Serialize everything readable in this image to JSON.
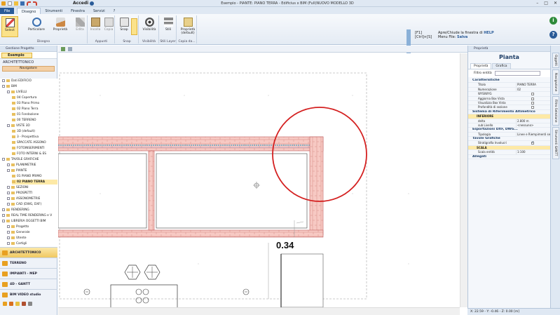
{
  "window": {
    "title": "Esempio - PIANTE: PIANO TERRA - Edificius x BIM (Full)NUOVO MODELLO 3D",
    "access_label": "Accedi",
    "controls": [
      "–",
      "□",
      "✕"
    ]
  },
  "ribbon_tabs": [
    {
      "label": "File"
    },
    {
      "label": "Disegno"
    },
    {
      "label": "Strumenti"
    },
    {
      "label": "Finestra"
    },
    {
      "label": "Servizi"
    },
    {
      "label": "?"
    }
  ],
  "ribbon": {
    "buttons": {
      "select": "Select",
      "particolare": "Particolare",
      "proprieta": "Proprietà",
      "edita": "Edita",
      "incolla": "Incolla",
      "copia": "Copia",
      "snap": "Snap",
      "visibilita": "Visibilità",
      "stili": "Stili",
      "proprieta_default": "Proprietà (default)"
    },
    "groups": {
      "disegno": "Disegno",
      "appunti": "Appunti",
      "snap": "Snap",
      "visibilita": "Visibilità",
      "stili_layer": "Stili Layer",
      "copia_da": "Copia da..."
    }
  },
  "help": {
    "key1": "[F1]",
    "key2": "[Ctrl]+[S]",
    "desc1_pre": "Apre/Chiude la finestra di ",
    "desc1_bold": "HELP",
    "desc2_pre": "Menu File: ",
    "desc2_bold": "Salva"
  },
  "left_panel": {
    "header": "Gestione Progetto",
    "project": "Esempio",
    "section": "ARCHITETTONICO",
    "navigator": "Navigatore",
    "tree": [
      {
        "label": "Dati EDIFICIO",
        "level": 0
      },
      {
        "label": "BIM",
        "level": 0
      },
      {
        "label": "LIVELLI",
        "level": 1
      },
      {
        "label": "04 Copertura",
        "level": 2
      },
      {
        "label": "03 Piano Primo",
        "level": 2
      },
      {
        "label": "02 Piano Terra",
        "level": 2
      },
      {
        "label": "01 Fondazione",
        "level": 2
      },
      {
        "label": "00 TERRENO",
        "level": 2
      },
      {
        "label": "VISTE 3D",
        "level": 1
      },
      {
        "label": "3D (default)",
        "level": 2
      },
      {
        "label": "3 - Prospettiva",
        "level": 2
      },
      {
        "label": "SPACCATE ASSONO",
        "level": 2
      },
      {
        "label": "FOTOINSERIMENTI",
        "level": 2
      },
      {
        "label": "FOTO INTERNI & ES",
        "level": 2
      },
      {
        "label": "TAVOLE GRAFICHE",
        "level": 0
      },
      {
        "label": "PLANIMETRIE",
        "level": 1
      },
      {
        "label": "PIANTE",
        "level": 1
      },
      {
        "label": "01 PIANO PRIMO",
        "level": 2
      },
      {
        "label": "02 PIANO TERRA",
        "level": 2,
        "selected": true
      },
      {
        "label": "SEZIONI",
        "level": 1
      },
      {
        "label": "PROSPETTI",
        "level": 1
      },
      {
        "label": "ASSONOMETRIE",
        "level": 1
      },
      {
        "label": "CAD (DWG, DXF)",
        "level": 1
      },
      {
        "label": "RENDERING",
        "level": 0
      },
      {
        "label": "REAL TIME RENDERING e V",
        "level": 0
      },
      {
        "label": "LIBRERIA OGGETTI BIM",
        "level": 0
      },
      {
        "label": "Progetto",
        "level": 1
      },
      {
        "label": "Generale",
        "level": 1
      },
      {
        "label": "Utente",
        "level": 1
      },
      {
        "label": "Cartigli",
        "level": 1
      }
    ],
    "modules": [
      {
        "label": "ARCHITETTONICO",
        "active": true
      },
      {
        "label": "TERRENO"
      },
      {
        "label": "IMPIANTI - MEP"
      },
      {
        "label": "4D - GANTT"
      },
      {
        "label": "BIM VIDEO studio"
      }
    ]
  },
  "drawing": {
    "dimension_label": "0.34"
  },
  "properties": {
    "panel_header": "Proprietà",
    "title": "Pianta",
    "tabs": [
      "Proprietà",
      "Grafica"
    ],
    "filter_label": "Filtro entità",
    "rows": [
      {
        "type": "sec",
        "label": "Caratteristiche"
      },
      {
        "type": "kv",
        "key": "Titolo",
        "value": "PIANO TERRA"
      },
      {
        "type": "kv",
        "key": "Numerazione",
        "value": "02"
      },
      {
        "type": "cb",
        "key": "WYSIWYG",
        "checked": false
      },
      {
        "type": "cb",
        "key": "Aggiorna Box Vista",
        "checked": false
      },
      {
        "type": "cb",
        "key": "Visualizza Box Vista",
        "checked": false
      },
      {
        "type": "cb",
        "key": "Profondità di sezione",
        "checked": false
      },
      {
        "type": "sec",
        "label": "Sistema di Riferimento Altimetrico"
      },
      {
        "type": "sub",
        "label": "INFERIORE"
      },
      {
        "type": "kv",
        "key": "delta",
        "value": "2.800 m"
      },
      {
        "type": "kv",
        "key": "sub Livello",
        "value": "<nessuno>"
      },
      {
        "type": "sec",
        "label": "Esportazioni DXF, DWG..."
      },
      {
        "type": "kv",
        "key": "Tipologia",
        "value": "Linee e Riempimenti se"
      },
      {
        "type": "sec",
        "label": "Tavole Grafiche"
      },
      {
        "type": "cb",
        "key": "Stratigrafia Involucri",
        "checked": true
      },
      {
        "type": "sub",
        "label": "SCALA"
      },
      {
        "type": "kv",
        "key": "Scala entità",
        "value": "1:100"
      },
      {
        "type": "sec",
        "label": "Allegati"
      }
    ]
  },
  "side_tabs": [
    "Oggetti",
    "Navigazione",
    "Filtro Selezione",
    "Strumenti GANTT"
  ],
  "status": "X: 22.59 - Y: -0.46 - Z: 0.00 [m]",
  "colors": {
    "accent": "#2a5b98",
    "wall_fill": "#f7c9c3",
    "wall_line": "#c06060",
    "insulation": "#4aa5c8",
    "highlight_circle": "#d42020",
    "selection": "#fde9a6"
  }
}
